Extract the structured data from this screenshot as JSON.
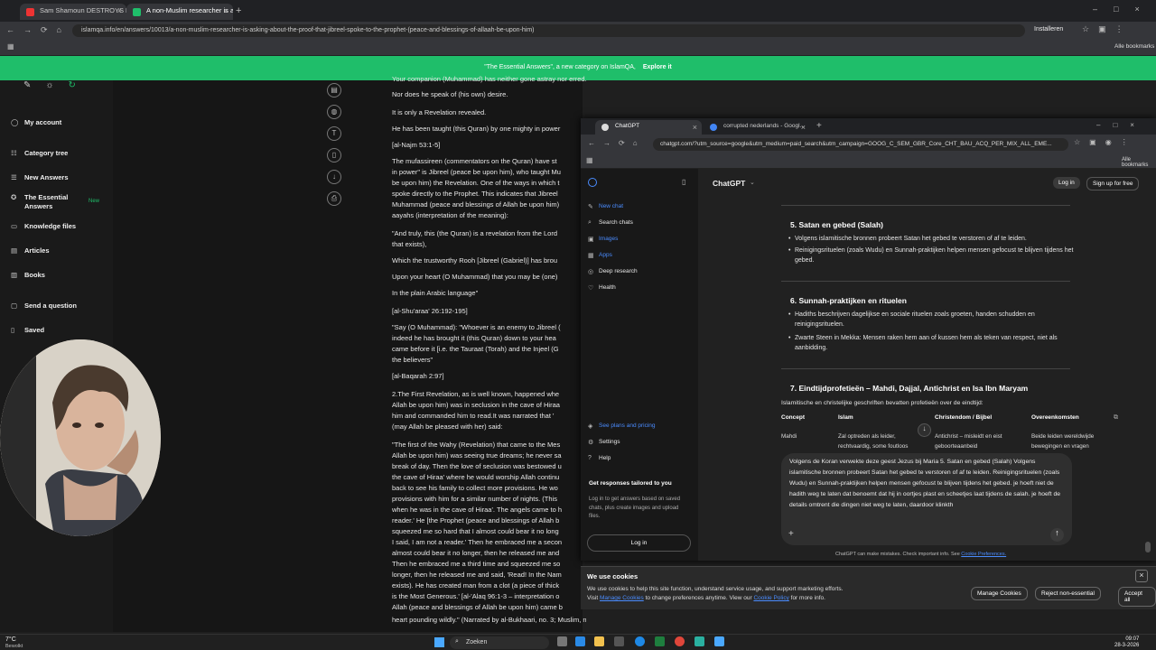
{
  "outer_browser": {
    "tabs": [
      {
        "label": "Sam Shamoun DESTROYS Mu..."
      },
      {
        "label": "A non-Muslim researcher is ask..."
      }
    ],
    "url": "islamqa.info/en/answers/10013/a-non-muslim-researcher-is-asking-about-the-proof-that-jibreel-spoke-to-the-prophet-(peace-and-blessings-of-allaah-be-upon-him)",
    "install_label": "Installeren",
    "bookmarks_label": "Alle bookmarks"
  },
  "banner": {
    "text": "\"The Essential Answers\", a new category on IslamQA,",
    "link": "Explore it"
  },
  "sidebar": {
    "items": [
      {
        "label": "My account",
        "icon": "user-icon"
      },
      {
        "label": "Category tree",
        "icon": "tree-icon"
      },
      {
        "label": "New Answers",
        "icon": "answers-icon"
      },
      {
        "label": "The Essential Answers",
        "icon": "star-icon",
        "badge": "New"
      },
      {
        "label": "Knowledge files",
        "icon": "file-icon"
      },
      {
        "label": "Articles",
        "icon": "article-icon"
      },
      {
        "label": "Books",
        "icon": "book-icon"
      },
      {
        "label": "Send a question",
        "icon": "chat-icon"
      },
      {
        "label": "Saved",
        "icon": "bookmark-icon"
      }
    ]
  },
  "article": {
    "lines": [
      "Your companion (Muhammad) has neither gone astray nor erred.",
      "Nor does he speak of (his own) desire.",
      "It is only a Revelation revealed.",
      "He has been taught (this Quran) by one mighty in power",
      "[al-Najm 53:1-5]",
      "The mufassireen (commentators on the Quran) have st",
      "in power\" is Jibreel (peace be upon him), who taught Mu",
      "be upon him) the Revelation. One of the ways in which t",
      "spoke directly to the Prophet. This indicates that Jibreel",
      "Muhammad (peace and blessings of Allah be upon him)",
      "aayahs (interpretation of the meaning):",
      "\"And truly, this (the Quran) is a revelation from the Lord",
      "that exists),",
      "Which the trustworthy Rooh [Jibreel (Gabriel)] has brou",
      "Upon your heart (O Muhammad) that you may be (one)",
      "In the plain Arabic language\"",
      "[al-Shu'araa' 26:192-195]",
      "\"Say (O Muhammad): \"Whoever is an enemy to Jibreel (",
      "indeed he has brought it (this Quran) down to your hea",
      "came before it [i.e. the Tauraat (Torah) and the Injeel (G",
      "the believers\"",
      "[al-Baqarah 2:97]",
      "2.The First Revelation, as is well known, happened whe",
      "Allah be upon him) was in seclusion in the cave of Hiraa",
      "him and commanded him to read.It was narrated that '",
      "(may Allah be pleased with her) said:",
      "\"The first of the Wahy (Revelation) that came to the Mes",
      "Allah be upon him) was seeing true dreams; he never sa",
      "break of day. Then the love of seclusion was bestowed u",
      "the cave of Hiraa' where he would worship Allah continu",
      "back to see his family to collect more provisions. He wo",
      "provisions with him for a similar number of nights. (This",
      "when he was in the cave of Hiraa'. The angels came to h",
      "reader.' He [the Prophet (peace and blessings of Allah b",
      "squeezed me so hard that I almost could bear it no long",
      "I said, I am not a reader.' Then he embraced me a secon",
      "almost could bear it no longer, then he released me and",
      "Then he embraced me a third time and squeezed me so",
      "longer, then he released me and said, 'Read! In the Nam",
      "exists). He has created man from a clot (a piece of thick",
      "is the Most Generous.' [al-'Alaq 96:1-3 – interpretation o",
      "Allah (peace and blessings of Allah be upon him) came b",
      "heart pounding wildly.\" (Narrated by al-Bukhaari, no. 3; Muslim, no. 231)."
    ]
  },
  "chatgpt_browser": {
    "tabs": [
      {
        "label": "ChatGPT"
      },
      {
        "label": "corrupted nederlands - Googl..."
      }
    ],
    "url": "chatgpt.com/?utm_source=google&utm_medium=paid_search&utm_campaign=GOOG_C_SEM_GBR_Core_CHT_BAU_ACQ_PER_MIX_ALL_EME...",
    "bookmarks_label": "Alle bookmarks"
  },
  "chatgpt": {
    "model": "ChatGPT",
    "login_label": "Log in",
    "signup_label": "Sign up for free",
    "sidebar": [
      {
        "label": "New chat",
        "icon": "edit-icon"
      },
      {
        "label": "Search chats",
        "icon": "search-icon"
      },
      {
        "label": "Images",
        "icon": "image-icon"
      },
      {
        "label": "Apps",
        "icon": "apps-icon"
      },
      {
        "label": "Deep research",
        "icon": "research-icon"
      },
      {
        "label": "Health",
        "icon": "heart-icon"
      }
    ],
    "sidebar_bottom": [
      {
        "label": "See plans and pricing"
      },
      {
        "label": "Settings"
      },
      {
        "label": "Help"
      }
    ],
    "promo": {
      "title": "Get responses tailored to you",
      "body": "Log in to get answers based on saved chats, plus create images and upload files.",
      "button": "Log in"
    },
    "sections": [
      {
        "heading": "5. Satan en gebed (Salah)",
        "items": [
          "Volgens islamitische bronnen probeert Satan het gebed te verstoren of af te leiden.",
          "Reinigingsrituelen (zoals Wudu) en Sunnah-praktijken helpen mensen gefocust te blijven tijdens het gebed."
        ]
      },
      {
        "heading": "6. Sunnah-praktijken en rituelen",
        "items": [
          "Hadiths beschrijven dagelijkse en sociale rituelen zoals groeten, handen schudden en reinigingsrituelen.",
          "Zwarte Steen in Mekka: Mensen raken hem aan of kussen hem als teken van respect, niet als aanbidding."
        ]
      },
      {
        "heading": "7. Eindtijdprofetieën – Mahdi, Dajjal, Antichrist en Isa Ibn Maryam",
        "intro": "Islamitische en christelijke geschriften bevatten profetieën over de eindtijd:"
      }
    ],
    "table": {
      "headers": [
        "Concept",
        "Islam",
        "Christendom / Bijbel",
        "Overeenkomsten"
      ],
      "row": [
        "Mahdi",
        "Zal optreden als leider, rechtvaardig, some foutloos",
        "Antichrist – misleidt en eist geboorteaanbeid",
        "Beide leiden wereldwijde bewegingen en vragen"
      ]
    },
    "input_text": "Volgens de Koran verwekte deze geest Jezus bij Maria 5. Satan en gebed (Salah) Volgens islamitische bronnen probeert Satan het gebed te verstoren of af te leiden. Reinigingsrituelen (zoals Wudu) en Sunnah-praktijken helpen mensen gefocust te blijven tijdens het gebed. je hoeft niet de hadith weg te laten dat benoemt dat hij in oortjes plast en scheetjes laat tijdens de salah. je hoeft de details omtrent die dingen niet weg te laten, daardoor klinkth",
    "disclaimer": "ChatGPT can make mistakes. Check important info. See",
    "disclaimer_link": "Cookie Preferences."
  },
  "cookies": {
    "title": "We use cookies",
    "body": "We use cookies to help this site function, understand service usage, and support marketing efforts.",
    "body2_a": "Visit",
    "link1": "Manage Cookies",
    "body2_b": "to change preferences anytime. View our",
    "link2": "Cookie Policy",
    "body2_c": "for more info.",
    "manage": "Manage Cookies",
    "reject": "Reject non-essential",
    "accept": "Accept all"
  },
  "taskbar": {
    "weather_temp": "7°C",
    "weather_desc": "Bewolkt",
    "search": "Zoeken",
    "time": "09:07",
    "date": "28-3-2026"
  }
}
